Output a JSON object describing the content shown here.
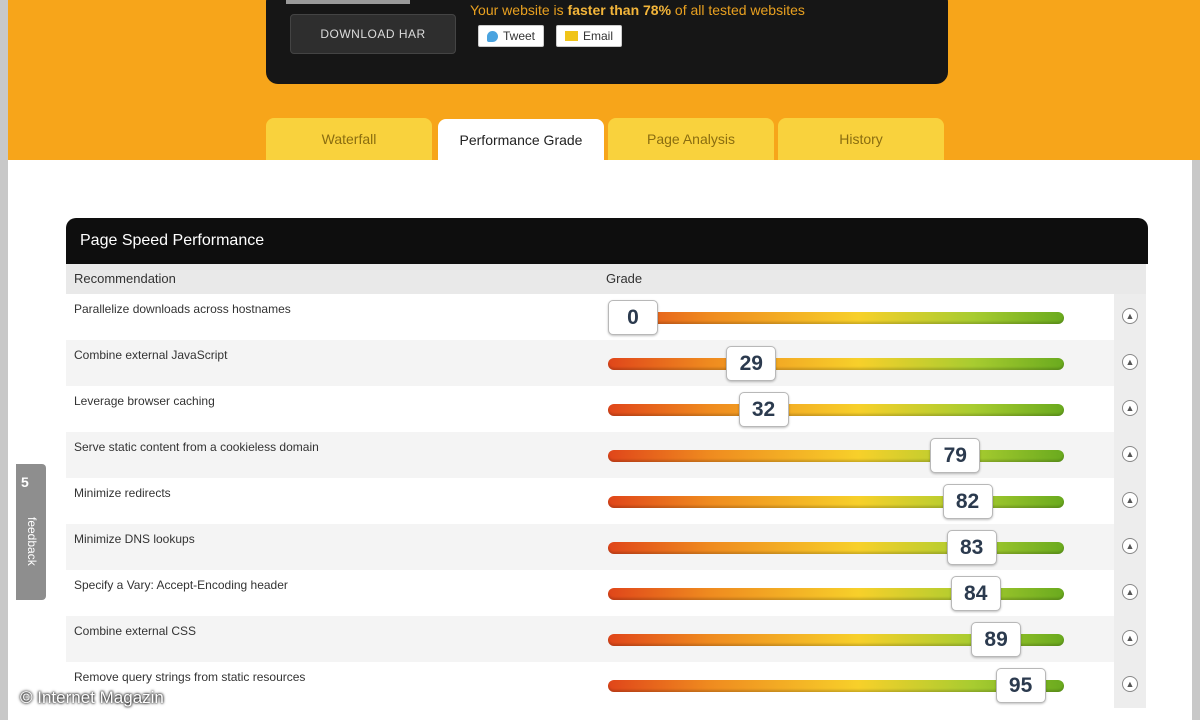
{
  "header": {
    "download_label": "DOWNLOAD HAR",
    "tagline_prefix": "Your website is ",
    "tagline_bold": "faster than 78%",
    "tagline_suffix": " of all tested websites",
    "tweet_label": "Tweet",
    "email_label": "Email"
  },
  "tabs": [
    {
      "label": "Waterfall",
      "active": false
    },
    {
      "label": "Performance Grade",
      "active": true
    },
    {
      "label": "Page Analysis",
      "active": false
    },
    {
      "label": "History",
      "active": false
    }
  ],
  "panel": {
    "title": "Page Speed Performance",
    "col_recommendation": "Recommendation",
    "col_grade": "Grade"
  },
  "rows": [
    {
      "label": "Parallelize downloads across hostnames",
      "grade": 0
    },
    {
      "label": "Combine external JavaScript",
      "grade": 29
    },
    {
      "label": "Leverage browser caching",
      "grade": 32
    },
    {
      "label": "Serve static content from a cookieless domain",
      "grade": 79
    },
    {
      "label": "Minimize redirects",
      "grade": 82
    },
    {
      "label": "Minimize DNS lookups",
      "grade": 83
    },
    {
      "label": "Specify a Vary: Accept-Encoding header",
      "grade": 84
    },
    {
      "label": "Combine external CSS",
      "grade": 89
    },
    {
      "label": "Remove query strings from static resources",
      "grade": 95
    }
  ],
  "side": {
    "feedback_number": "5",
    "feedback_label": "feedback"
  },
  "watermark": "© Internet Magazin",
  "colors": {
    "orange": "#f7a51a",
    "tab_yellow": "#f9d23d",
    "dark": "#0e0e0e"
  }
}
